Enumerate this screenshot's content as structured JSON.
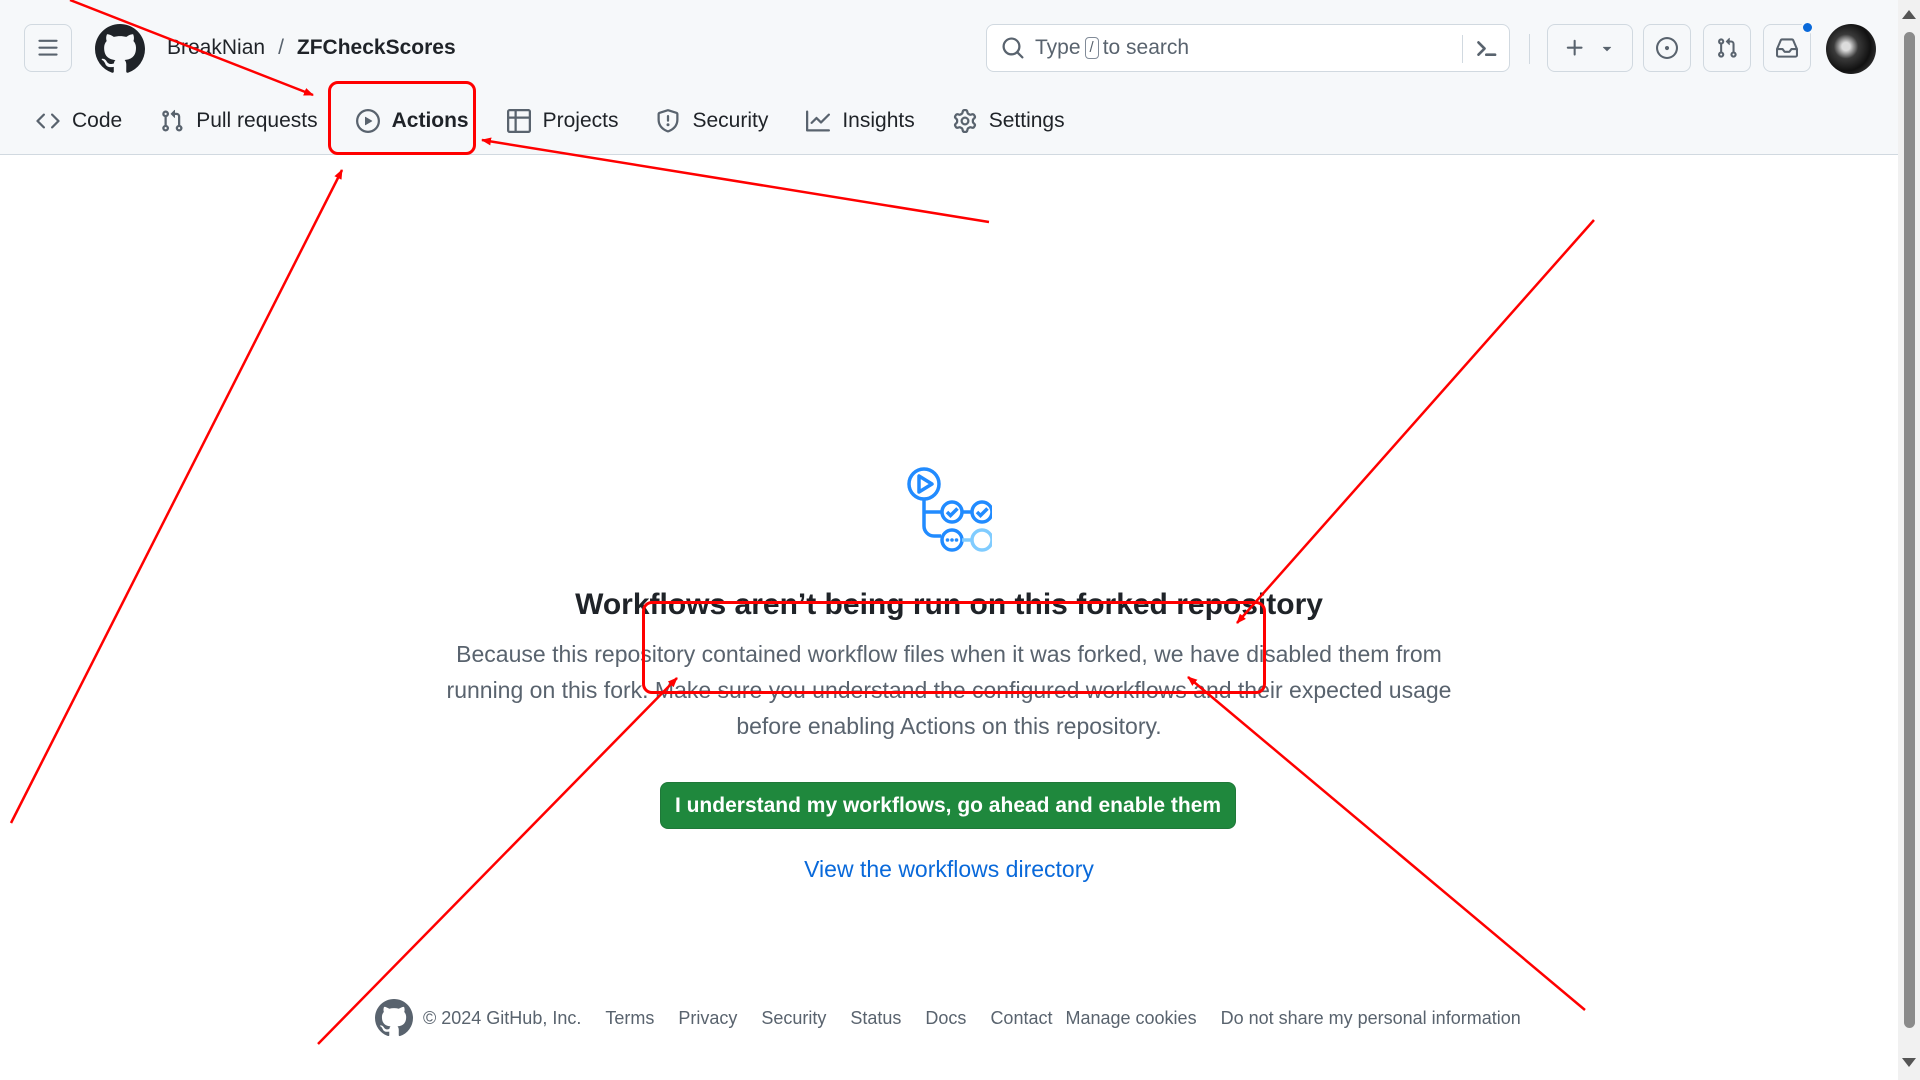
{
  "header": {
    "owner": "BreakNian",
    "separator": "/",
    "repo": "ZFCheckScores",
    "search": {
      "placeholder_prefix": "Type",
      "shortcut": "/",
      "placeholder_suffix": "to search"
    }
  },
  "tabs": [
    {
      "label": "Code",
      "icon": "code-icon"
    },
    {
      "label": "Pull requests",
      "icon": "git-pull-request-icon"
    },
    {
      "label": "Actions",
      "icon": "play-icon"
    },
    {
      "label": "Projects",
      "icon": "table-icon"
    },
    {
      "label": "Security",
      "icon": "shield-icon"
    },
    {
      "label": "Insights",
      "icon": "graph-icon"
    },
    {
      "label": "Settings",
      "icon": "gear-icon"
    }
  ],
  "main": {
    "title": "Workflows aren’t being run on this forked repository",
    "description": "Because this repository contained workflow files when it was forked, we have disabled them from running on this fork. Make sure you understand the configured workflows and their expected usage before enabling Actions on this repository.",
    "enable_button": "I understand my workflows, go ahead and enable them",
    "view_link": "View the workflows directory"
  },
  "footer": {
    "copyright": "© 2024 GitHub, Inc.",
    "links": [
      "Terms",
      "Privacy",
      "Security",
      "Status",
      "Docs",
      "Contact",
      "Manage cookies",
      "Do not share my personal information"
    ]
  },
  "colors": {
    "primary_button": "#1f883d",
    "link": "#0969da",
    "annotation": "#ff0000",
    "notification_dot": "#0969da"
  }
}
